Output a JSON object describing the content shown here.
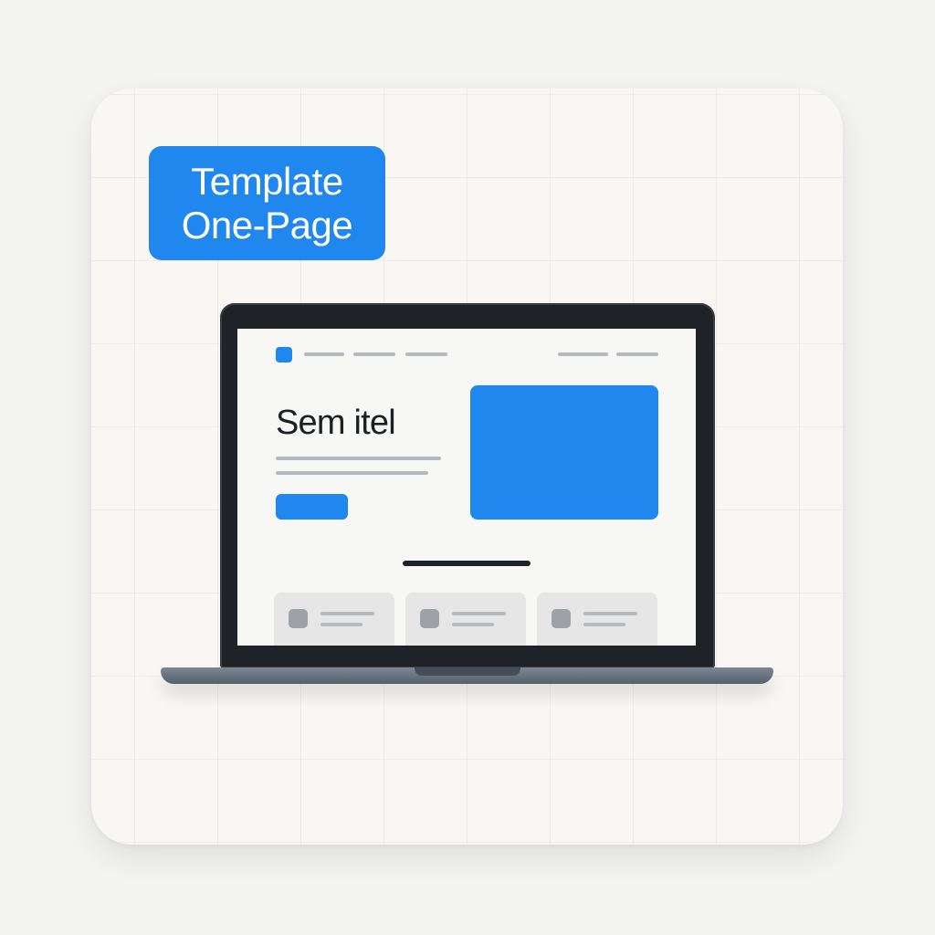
{
  "badge": {
    "line1": "Template",
    "line2": "One-Page"
  },
  "mockup": {
    "headline": "Sem itel",
    "nav_items": 3,
    "nav_right_items": 2,
    "feature_cards": 3
  },
  "colors": {
    "accent": "#1f87ee",
    "background": "#f4f4f3",
    "card": "#f8f7f4",
    "laptop_bezel": "#1f2226",
    "laptop_base": "#6b7580",
    "placeholder_line": "#b5b8bc",
    "feature_card": "#e6e6e7"
  }
}
